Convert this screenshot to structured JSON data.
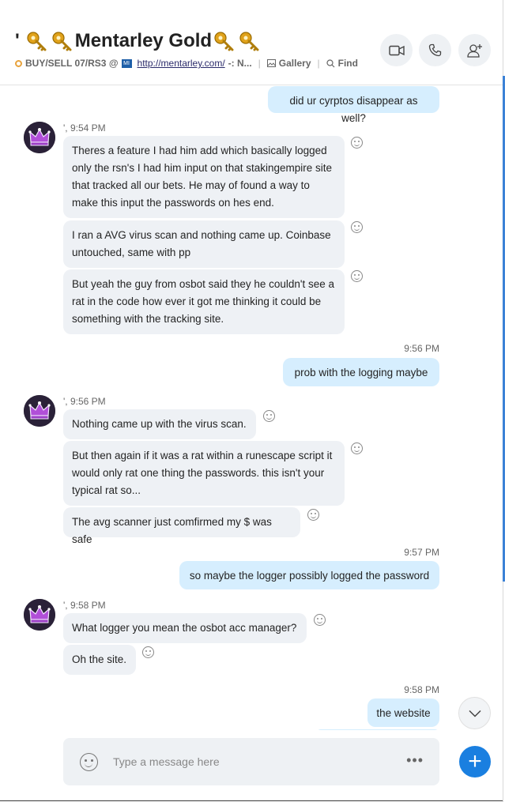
{
  "window": {
    "minimize": "─",
    "maximize": "☐",
    "close": "✕"
  },
  "header": {
    "title_prefix": "'",
    "title": "Mentarley Gold",
    "mood_prefix": "BUY/SELL 07/RS3 @",
    "mini_logo": "MI",
    "link": "http://mentarley.com/",
    "mood_suffix": "-: N...",
    "gallery": "Gallery",
    "find": "Find"
  },
  "messages": [
    {
      "type": "out",
      "text": "did ur cyrptos disappear as well?"
    },
    {
      "type": "sender",
      "time": "', 9:54 PM"
    },
    {
      "type": "in",
      "text": "Theres a feature I had him add which basically logged only the rsn's I had him input on that stakingempire site that tracked all our bets. He may of found a way to make this input the passwords on hes end."
    },
    {
      "type": "in",
      "text": "I ran a AVG virus scan and nothing came up. Coinbase untouched, same with pp"
    },
    {
      "type": "in",
      "text": "But yeah the guy from osbot said they he couldn't see a rat in the code how ever it got me thinking it could be something with the tracking site."
    },
    {
      "type": "time",
      "text": "9:56 PM"
    },
    {
      "type": "out",
      "text": "prob with the logging maybe"
    },
    {
      "type": "sender",
      "time": "', 9:56 PM"
    },
    {
      "type": "in",
      "text": "Nothing came up with the virus scan."
    },
    {
      "type": "in",
      "text": "But then again if it was a rat within a runescape script it would only rat one thing the passwords. this isn't your typical rat so..."
    },
    {
      "type": "in",
      "text": "The avg scanner just comfirmed my $ was safe"
    },
    {
      "type": "time",
      "text": "9:57 PM"
    },
    {
      "type": "out",
      "text": "so maybe the logger possibly logged the password"
    },
    {
      "type": "sender",
      "time": "', 9:58 PM"
    },
    {
      "type": "in",
      "text": "What logger you mean the osbot acc manager?"
    },
    {
      "type": "in",
      "text": "Oh the site."
    },
    {
      "type": "time",
      "text": "9:58 PM"
    },
    {
      "type": "out",
      "text": "the website"
    }
  ],
  "composer": {
    "placeholder": "Type a message here",
    "more": "•••"
  },
  "add_button": "+"
}
